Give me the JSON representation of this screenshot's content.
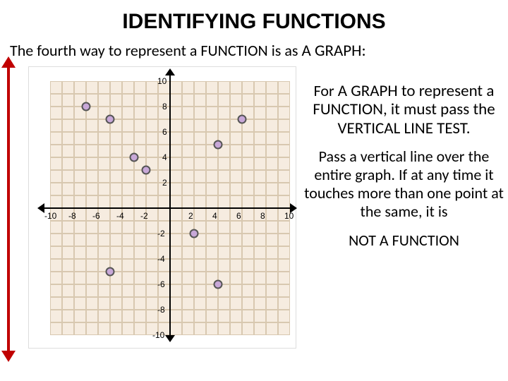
{
  "title": "IDENTIFYING FUNCTIONS",
  "subtitle_a": "The fourth way to represent a FUNCTION is as ",
  "subtitle_b": "A GRAPH:",
  "right": {
    "p1_a": "For ",
    "p1_b": "A GRAPH to represent a FUNCTION, it must pass  the VERTICAL LINE TEST.",
    "p2": "Pass a vertical line over the entire graph.  If at any time it touches more than one point at the same, it is",
    "p3": "NOT A FUNCTION"
  },
  "axis": {
    "xmin": -10,
    "xmax": 10,
    "ymin": -10,
    "ymax": 10,
    "xticks": [
      -10,
      -8,
      -6,
      -4,
      -2,
      2,
      4,
      6,
      8,
      10
    ],
    "yticks": [
      -10,
      -8,
      -6,
      -4,
      -2,
      2,
      4,
      6,
      8,
      10
    ]
  },
  "chart_data": {
    "type": "scatter",
    "title": "",
    "xlabel": "",
    "ylabel": "",
    "xlim": [
      -10,
      10
    ],
    "ylim": [
      -10,
      10
    ],
    "grid": true,
    "series": [
      {
        "name": "points",
        "x": [
          -7,
          -5,
          -5,
          -3,
          -2,
          2,
          4,
          4,
          6
        ],
        "y": [
          8,
          7,
          -5,
          4,
          3,
          -2,
          5,
          -6,
          7
        ]
      }
    ]
  }
}
